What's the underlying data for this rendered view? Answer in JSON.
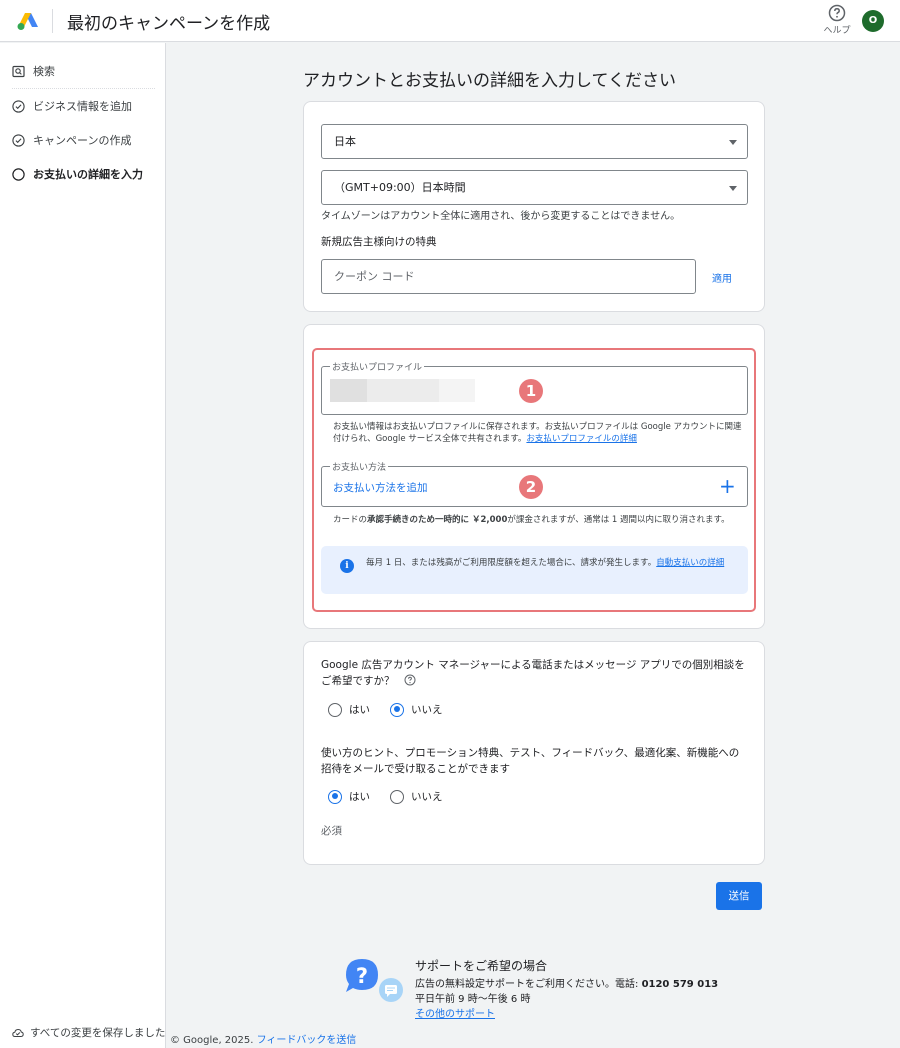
{
  "header": {
    "title": "最初のキャンペーンを作成",
    "help_label": "ヘルプ",
    "avatar_initial": "O"
  },
  "sidebar": {
    "items": [
      {
        "label": "検索",
        "icon": "search-box-icon",
        "state": "done"
      },
      {
        "label": "ビジネス情報を追加",
        "icon": "check-circle-icon",
        "state": "done"
      },
      {
        "label": "キャンペーンの作成",
        "icon": "check-circle-icon",
        "state": "done"
      },
      {
        "label": "お支払いの詳細を入力",
        "icon": "empty-circle-icon",
        "state": "current"
      }
    ],
    "saved_status": "すべての変更を保存しました"
  },
  "main": {
    "title": "アカウントとお支払いの詳細を入力してください",
    "account": {
      "country": "日本",
      "timezone": "（GMT+09:00）日本時間",
      "timezone_note": "タイムゾーンはアカウント全体に適用され、後から変更することはできません。",
      "promo_heading": "新規広告主様向けの特典",
      "coupon_placeholder": "クーポン コード",
      "apply_label": "適用"
    },
    "payment": {
      "profile_legend": "お支払いプロファイル",
      "profile_note": "お支払い情報はお支払いプロファイルに保存されます。お支払いプロファイルは Google アカウントに関連付けられ、Google サービス全体で共有されます。",
      "profile_link": "お支払いプロファイルの詳細",
      "badge_1": "1",
      "method_legend": "お支払い方法",
      "add_method_label": "お支払い方法を追加",
      "add_icon": "+",
      "badge_2": "2",
      "card_note_prefix": "カードの",
      "card_note_bold": "承認手続きのため一時的に ￥2,000",
      "card_note_suffix": "が課金されますが、通常は 1 週間以内に取り消されます。",
      "info_text": "毎月 1 日、または残高がご利用限度額を超えた場合に、請求が発生します。",
      "info_link": "自動支払いの詳細"
    },
    "preferences": {
      "q1": "Google 広告アカウント マネージャーによる電話またはメッセージ アプリでの個別相談をご希望ですか？",
      "q1_options": [
        "はい",
        "いいえ"
      ],
      "q1_selected": "いいえ",
      "q2": "使い方のヒント、プロモーション特典、テスト、フィードバック、最適化案、新機能への招待をメールで受け取ることができます",
      "q2_options": [
        "はい",
        "いいえ"
      ],
      "q2_selected": "はい",
      "required_label": "必須"
    },
    "submit_label": "送信"
  },
  "support": {
    "title": "サポートをご希望の場合",
    "line1_prefix": "広告の無料設定サポートをご利用ください。電話: ",
    "phone": "0120 579 013",
    "line2": "平日午前 9 時〜午後 6 時",
    "link": "その他のサポート"
  },
  "footer": {
    "copyright": "© Google, 2025. ",
    "feedback_link": "フィードバックを送信"
  },
  "colors": {
    "accent": "#1a73e8",
    "highlight": "#e8777a",
    "avatar": "#1e6b2c",
    "info_bg": "#e8f0fe"
  }
}
